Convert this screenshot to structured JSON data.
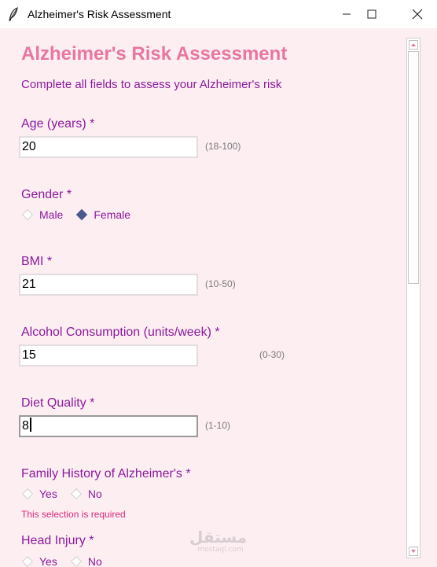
{
  "window": {
    "title": "Alzheimer's Risk Assessment"
  },
  "form": {
    "title": "Alzheimer's Risk Assessment",
    "subtitle": "Complete all fields to assess your Alzheimer's risk",
    "age": {
      "label": "Age (years) *",
      "value": "20",
      "hint": "(18-100)"
    },
    "gender": {
      "label": "Gender *",
      "options": [
        "Male",
        "Female"
      ],
      "selected": "Female"
    },
    "bmi": {
      "label": "BMI *",
      "value": "21",
      "hint": "(10-50)"
    },
    "alcohol": {
      "label": "Alcohol Consumption (units/week) *",
      "value": "15",
      "hint": "(0-30)"
    },
    "diet": {
      "label": "Diet Quality *",
      "value": "8",
      "hint": "(1-10)"
    },
    "family_history": {
      "label": "Family History of Alzheimer's *",
      "options": [
        "Yes",
        "No"
      ],
      "selected": null,
      "error": "This selection is required"
    },
    "head_injury": {
      "label": "Head Injury *",
      "options": [
        "Yes",
        "No"
      ]
    }
  },
  "watermark": {
    "arabic": "مستقل",
    "latin": "mostaql.com"
  },
  "colors": {
    "background": "#fdeef2",
    "title": "#e8769f",
    "label": "#8b1a9c",
    "error": "#e0287a",
    "radio_selected": "#4a5a8a"
  },
  "scrollbar": {
    "thumb_fraction": 0.45,
    "position_fraction": 0.0
  }
}
